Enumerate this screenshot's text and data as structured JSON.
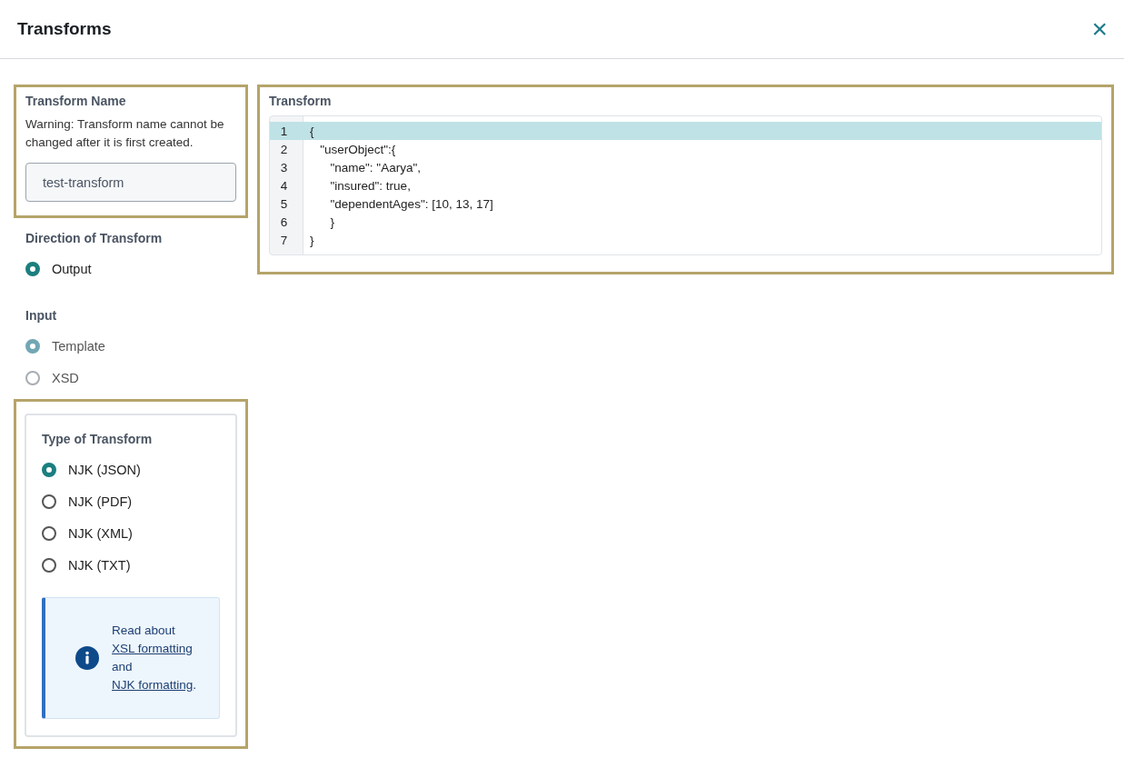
{
  "header": {
    "title": "Transforms",
    "close_icon": "×"
  },
  "transform_name": {
    "label": "Transform Name",
    "warning": "Warning: Transform name cannot be changed after it is first created.",
    "value": "test-transform",
    "highlighted": true
  },
  "direction": {
    "label": "Direction of Transform",
    "options": [
      {
        "label": "Output",
        "selected": true,
        "disabled": false
      }
    ]
  },
  "input": {
    "label": "Input",
    "options": [
      {
        "label": "Template",
        "selected": true,
        "disabled": true
      },
      {
        "label": "XSD",
        "selected": false,
        "disabled": true
      }
    ]
  },
  "type_of_transform": {
    "label": "Type of Transform",
    "highlighted": true,
    "options": [
      {
        "label": "NJK (JSON)",
        "selected": true,
        "disabled": false
      },
      {
        "label": "NJK (PDF)",
        "selected": false,
        "disabled": false
      },
      {
        "label": "NJK (XML)",
        "selected": false,
        "disabled": false
      },
      {
        "label": "NJK (TXT)",
        "selected": false,
        "disabled": false
      }
    ],
    "info": {
      "parts": [
        {
          "kind": "text",
          "text": "Read about "
        },
        {
          "kind": "link",
          "text": "XSL formatting"
        },
        {
          "kind": "text",
          "text": " and "
        },
        {
          "kind": "link",
          "text": "NJK formatting"
        },
        {
          "kind": "text",
          "text": "."
        }
      ]
    }
  },
  "transform": {
    "label": "Transform",
    "highlighted": true,
    "lines": [
      {
        "number": "1",
        "code": "{",
        "active": true
      },
      {
        "number": "2",
        "code": "   \"userObject\":{",
        "active": false
      },
      {
        "number": "3",
        "code": "      \"name\": \"Aarya\",",
        "active": false
      },
      {
        "number": "4",
        "code": "      \"insured\": true,",
        "active": false
      },
      {
        "number": "5",
        "code": "      \"dependentAges\": [10, 13, 17]",
        "active": false
      },
      {
        "number": "6",
        "code": "      }",
        "active": false
      },
      {
        "number": "7",
        "code": "}",
        "active": false
      }
    ]
  }
}
